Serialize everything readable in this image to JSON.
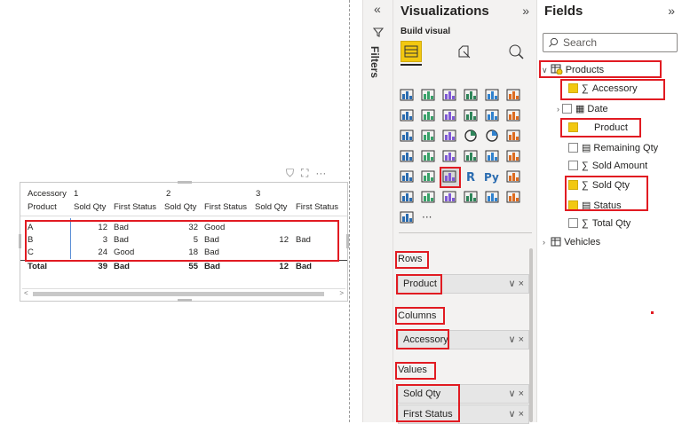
{
  "matrix": {
    "header1": [
      "Accessory",
      "1",
      "2",
      "3"
    ],
    "header2": [
      "Product",
      "Sold Qty",
      "First Status",
      "Sold Qty",
      "First Status",
      "Sold Qty",
      "First Status"
    ],
    "rows": [
      [
        "A",
        "12",
        "Bad",
        "32",
        "Good",
        "",
        ""
      ],
      [
        "B",
        "3",
        "Bad",
        "5",
        "Bad",
        "12",
        "Bad"
      ],
      [
        "C",
        "24",
        "Good",
        "18",
        "Bad",
        "",
        ""
      ]
    ],
    "total": [
      "Total",
      "39",
      "Bad",
      "55",
      "Bad",
      "12",
      "Bad"
    ]
  },
  "visual_actions": {
    "filter": "⛉",
    "focus": "⛶",
    "more": "···"
  },
  "filters_pane": {
    "collapse": "«",
    "label": "Filters"
  },
  "viz_pane": {
    "title": "Visualizations",
    "expand": "»",
    "subtitle": "Build visual",
    "more": "···",
    "wells": {
      "rows_label": "Rows",
      "rows_field": "Product",
      "columns_label": "Columns",
      "columns_field": "Accessory",
      "values_label": "Values",
      "values_1": "Sold Qty",
      "values_2": "First Status",
      "chevron": "∨",
      "remove": "×"
    }
  },
  "fields_pane": {
    "title": "Fields",
    "expand": "»",
    "search_placeholder": "Search",
    "tables": {
      "products": "Products",
      "vehicles": "Vehicles"
    },
    "fields": [
      "Accessory",
      "Date",
      "Product",
      "Remaining Qty",
      "Sold Amount",
      "Sold Qty",
      "Status",
      "Total Qty"
    ],
    "sigma": "∑"
  },
  "colors": {
    "accent": "#f2c811",
    "highlight": "#e11b22",
    "selected_blue": "#5a8ed6"
  }
}
